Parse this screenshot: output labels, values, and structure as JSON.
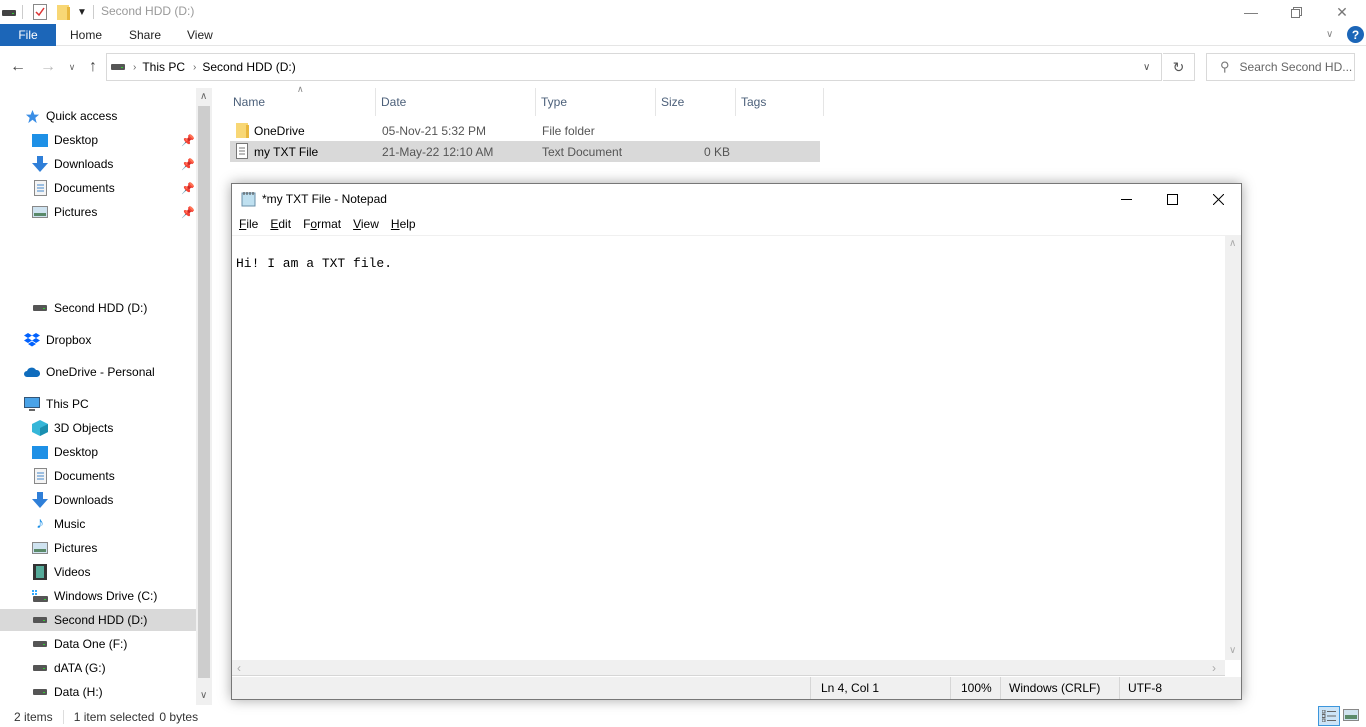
{
  "explorer": {
    "window_title": "Second HDD (D:)",
    "ribbon_tabs": [
      "File",
      "Home",
      "Share",
      "View"
    ],
    "breadcrumb": [
      "This PC",
      "Second HDD (D:)"
    ],
    "search_placeholder": "Search Second HD...",
    "columns": [
      "Name",
      "Date",
      "Type",
      "Size",
      "Tags"
    ],
    "files": [
      {
        "name": "OneDrive",
        "date": "05-Nov-21 5:32 PM",
        "type": "File folder",
        "size": "",
        "icon": "folder-icon",
        "selected": false
      },
      {
        "name": "my TXT File",
        "date": "21-May-22 12:10 AM",
        "type": "Text Document",
        "size": "0 KB",
        "icon": "text-file-icon",
        "selected": true
      }
    ],
    "nav": {
      "quick_access": {
        "label": "Quick access",
        "items": [
          "Desktop",
          "Downloads",
          "Documents",
          "Pictures"
        ]
      },
      "second_hdd": "Second HDD (D:)",
      "dropbox": "Dropbox",
      "onedrive": "OneDrive - Personal",
      "this_pc": {
        "label": "This PC",
        "items": [
          "3D Objects",
          "Desktop",
          "Documents",
          "Downloads",
          "Music",
          "Pictures",
          "Videos",
          "Windows Drive (C:)",
          "Second HDD (D:)",
          "Data One (F:)",
          "dATA (G:)",
          "Data (H:)"
        ]
      },
      "selected": "Second HDD (D:)"
    },
    "status": {
      "items": "2 items",
      "selected": "1 item selected",
      "size": "0 bytes"
    }
  },
  "notepad": {
    "title": "*my TXT File - Notepad",
    "menu": [
      {
        "key": "F",
        "rest": "ile"
      },
      {
        "key": "E",
        "rest": "dit"
      },
      {
        "pre": "F",
        "key": "o",
        "rest": "rmat"
      },
      {
        "key": "V",
        "rest": "iew"
      },
      {
        "key": "H",
        "rest": "elp"
      }
    ],
    "content": "Hi! I am a TXT file.",
    "status": {
      "position": "Ln 4, Col 1",
      "zoom": "100%",
      "line_ending": "Windows (CRLF)",
      "encoding": "UTF-8"
    }
  }
}
